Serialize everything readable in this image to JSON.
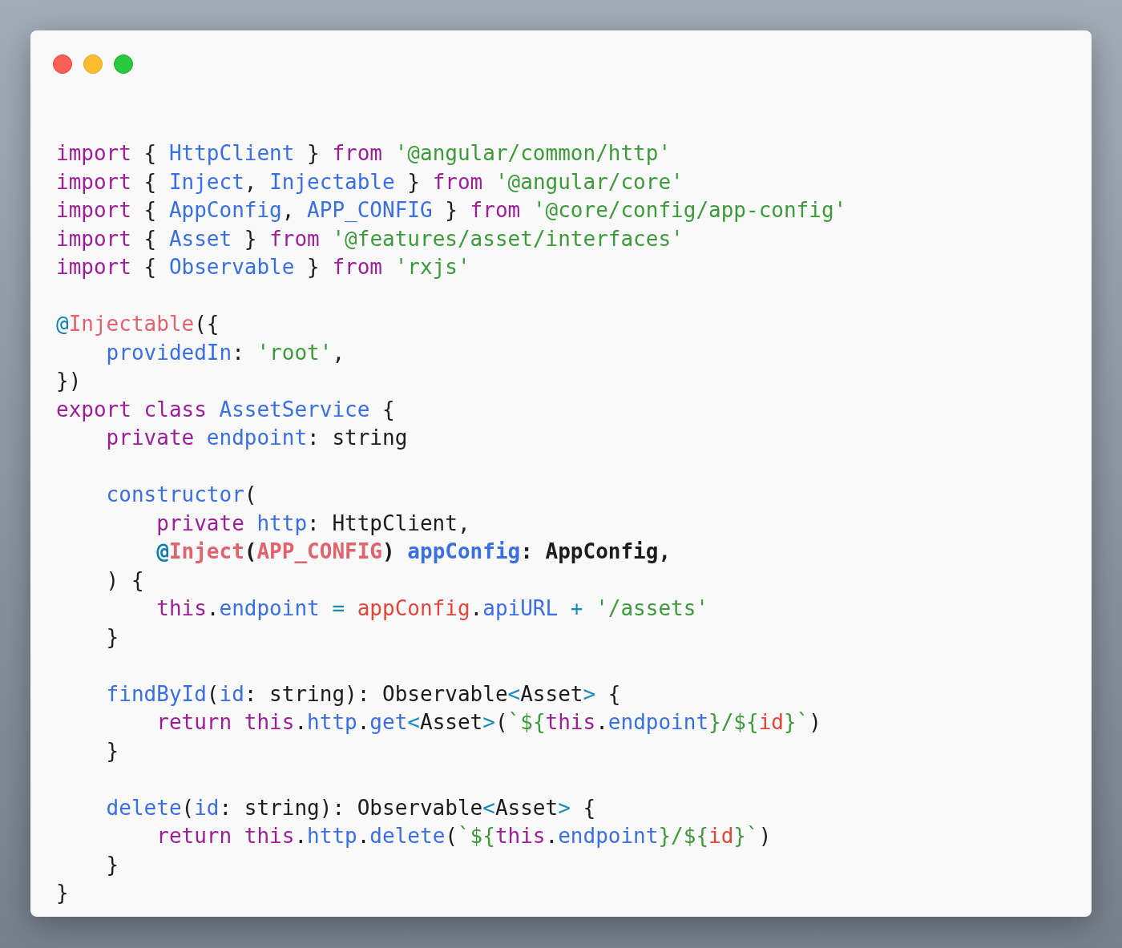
{
  "window": {
    "buttons": [
      {
        "kind": "close"
      },
      {
        "kind": "minimize"
      },
      {
        "kind": "zoom"
      }
    ]
  },
  "code": {
    "blocks": [
      {
        "lines": [
          {
            "bold": false,
            "tokens": [
              {
                "kind": "keyword",
                "text": "import"
              },
              {
                "kind": "plain",
                "text": " { "
              },
              {
                "kind": "name",
                "text": "HttpClient"
              },
              {
                "kind": "plain",
                "text": " } "
              },
              {
                "kind": "keyword",
                "text": "from "
              },
              {
                "kind": "string",
                "text": "'@angular/common/http'"
              }
            ]
          },
          {
            "bold": false,
            "tokens": [
              {
                "kind": "keyword",
                "text": "import"
              },
              {
                "kind": "plain",
                "text": " { "
              },
              {
                "kind": "name",
                "text": "Inject"
              },
              {
                "kind": "plain",
                "text": ", "
              },
              {
                "kind": "name",
                "text": "Injectable"
              },
              {
                "kind": "plain",
                "text": " } "
              },
              {
                "kind": "keyword",
                "text": "from "
              },
              {
                "kind": "string",
                "text": "'@angular/core'"
              }
            ]
          },
          {
            "bold": false,
            "tokens": [
              {
                "kind": "keyword",
                "text": "import"
              },
              {
                "kind": "plain",
                "text": " { "
              },
              {
                "kind": "name",
                "text": "AppConfig"
              },
              {
                "kind": "plain",
                "text": ", "
              },
              {
                "kind": "name",
                "text": "APP_CONFIG"
              },
              {
                "kind": "plain",
                "text": " } "
              },
              {
                "kind": "keyword",
                "text": "from "
              },
              {
                "kind": "string",
                "text": "'@core/config/app-config'"
              }
            ]
          },
          {
            "bold": false,
            "tokens": [
              {
                "kind": "keyword",
                "text": "import"
              },
              {
                "kind": "plain",
                "text": " { "
              },
              {
                "kind": "name",
                "text": "Asset"
              },
              {
                "kind": "plain",
                "text": " } "
              },
              {
                "kind": "keyword",
                "text": "from "
              },
              {
                "kind": "string",
                "text": "'@features/asset/interfaces'"
              }
            ]
          },
          {
            "bold": false,
            "tokens": [
              {
                "kind": "keyword",
                "text": "import"
              },
              {
                "kind": "plain",
                "text": " { "
              },
              {
                "kind": "name",
                "text": "Observable"
              },
              {
                "kind": "plain",
                "text": " } "
              },
              {
                "kind": "keyword",
                "text": "from "
              },
              {
                "kind": "string",
                "text": "'rxjs'"
              }
            ]
          }
        ]
      },
      {
        "lines": [
          {
            "bold": false,
            "tokens": [
              {
                "kind": "at",
                "text": "@"
              },
              {
                "kind": "decorator",
                "text": "Injectable"
              },
              {
                "kind": "plain",
                "text": "({"
              }
            ]
          },
          {
            "bold": false,
            "tokens": [
              {
                "kind": "name",
                "text": "    providedIn"
              },
              {
                "kind": "plain",
                "text": ": "
              },
              {
                "kind": "string",
                "text": "'root'"
              },
              {
                "kind": "plain",
                "text": ","
              }
            ]
          },
          {
            "bold": false,
            "tokens": [
              {
                "kind": "plain",
                "text": "})"
              }
            ]
          },
          {
            "bold": false,
            "tokens": [
              {
                "kind": "keyword",
                "text": "export class "
              },
              {
                "kind": "name",
                "text": "AssetService"
              },
              {
                "kind": "plain",
                "text": " {"
              }
            ]
          },
          {
            "bold": false,
            "tokens": [
              {
                "kind": "keyword",
                "text": "    private "
              },
              {
                "kind": "name",
                "text": "endpoint"
              },
              {
                "kind": "plain",
                "text": ": string"
              }
            ]
          }
        ]
      },
      {
        "lines": [
          {
            "bold": false,
            "tokens": [
              {
                "kind": "name",
                "text": "    constructor"
              },
              {
                "kind": "plain",
                "text": "("
              }
            ]
          },
          {
            "bold": false,
            "tokens": [
              {
                "kind": "keyword",
                "text": "        private "
              },
              {
                "kind": "name",
                "text": "http"
              },
              {
                "kind": "plain",
                "text": ": HttpClient,"
              }
            ]
          },
          {
            "bold": true,
            "tokens": [
              {
                "kind": "at",
                "text": "        @"
              },
              {
                "kind": "decorator",
                "text": "Inject"
              },
              {
                "kind": "plain",
                "text": "("
              },
              {
                "kind": "decorator",
                "text": "APP_CONFIG"
              },
              {
                "kind": "plain",
                "text": ") "
              },
              {
                "kind": "name",
                "text": "appConfig"
              },
              {
                "kind": "plain",
                "text": ": AppConfig,"
              }
            ]
          },
          {
            "bold": false,
            "tokens": [
              {
                "kind": "plain",
                "text": "    ) {"
              }
            ]
          },
          {
            "bold": false,
            "tokens": [
              {
                "kind": "keyword",
                "text": "        this"
              },
              {
                "kind": "plain",
                "text": "."
              },
              {
                "kind": "name",
                "text": "endpoint"
              },
              {
                "kind": "operator",
                "text": " = "
              },
              {
                "kind": "variable",
                "text": "appConfig"
              },
              {
                "kind": "plain",
                "text": "."
              },
              {
                "kind": "name",
                "text": "apiURL"
              },
              {
                "kind": "operator",
                "text": " + "
              },
              {
                "kind": "string",
                "text": "'/assets'"
              }
            ]
          },
          {
            "bold": false,
            "tokens": [
              {
                "kind": "plain",
                "text": "    }"
              }
            ]
          }
        ]
      },
      {
        "lines": [
          {
            "bold": false,
            "tokens": [
              {
                "kind": "name",
                "text": "    findById"
              },
              {
                "kind": "plain",
                "text": "("
              },
              {
                "kind": "name",
                "text": "id"
              },
              {
                "kind": "plain",
                "text": ": string): Observable"
              },
              {
                "kind": "operator",
                "text": "<"
              },
              {
                "kind": "plain",
                "text": "Asset"
              },
              {
                "kind": "operator",
                "text": ">"
              },
              {
                "kind": "plain",
                "text": " {"
              }
            ]
          },
          {
            "bold": false,
            "tokens": [
              {
                "kind": "keyword",
                "text": "        return this"
              },
              {
                "kind": "plain",
                "text": "."
              },
              {
                "kind": "name",
                "text": "http"
              },
              {
                "kind": "plain",
                "text": "."
              },
              {
                "kind": "name",
                "text": "get"
              },
              {
                "kind": "operator",
                "text": "<"
              },
              {
                "kind": "plain",
                "text": "Asset"
              },
              {
                "kind": "operator",
                "text": ">"
              },
              {
                "kind": "plain",
                "text": "("
              },
              {
                "kind": "string",
                "text": "`${"
              },
              {
                "kind": "keyword",
                "text": "this"
              },
              {
                "kind": "plain",
                "text": "."
              },
              {
                "kind": "name",
                "text": "endpoint"
              },
              {
                "kind": "string",
                "text": "}/${"
              },
              {
                "kind": "variable",
                "text": "id"
              },
              {
                "kind": "string",
                "text": "}`"
              },
              {
                "kind": "plain",
                "text": ")"
              }
            ]
          },
          {
            "bold": false,
            "tokens": [
              {
                "kind": "plain",
                "text": "    }"
              }
            ]
          }
        ]
      },
      {
        "lines": [
          {
            "bold": false,
            "tokens": [
              {
                "kind": "name",
                "text": "    delete"
              },
              {
                "kind": "plain",
                "text": "("
              },
              {
                "kind": "name",
                "text": "id"
              },
              {
                "kind": "plain",
                "text": ": string): Observable"
              },
              {
                "kind": "operator",
                "text": "<"
              },
              {
                "kind": "plain",
                "text": "Asset"
              },
              {
                "kind": "operator",
                "text": ">"
              },
              {
                "kind": "plain",
                "text": " {"
              }
            ]
          },
          {
            "bold": false,
            "tokens": [
              {
                "kind": "keyword",
                "text": "        return this"
              },
              {
                "kind": "plain",
                "text": "."
              },
              {
                "kind": "name",
                "text": "http"
              },
              {
                "kind": "plain",
                "text": "."
              },
              {
                "kind": "name",
                "text": "delete"
              },
              {
                "kind": "plain",
                "text": "("
              },
              {
                "kind": "string",
                "text": "`${"
              },
              {
                "kind": "keyword",
                "text": "this"
              },
              {
                "kind": "plain",
                "text": "."
              },
              {
                "kind": "name",
                "text": "endpoint"
              },
              {
                "kind": "string",
                "text": "}/${"
              },
              {
                "kind": "variable",
                "text": "id"
              },
              {
                "kind": "string",
                "text": "}`"
              },
              {
                "kind": "plain",
                "text": ")"
              }
            ]
          },
          {
            "bold": false,
            "tokens": [
              {
                "kind": "plain",
                "text": "    }"
              }
            ]
          },
          {
            "bold": false,
            "tokens": [
              {
                "kind": "plain",
                "text": "}"
              }
            ]
          }
        ]
      }
    ]
  }
}
